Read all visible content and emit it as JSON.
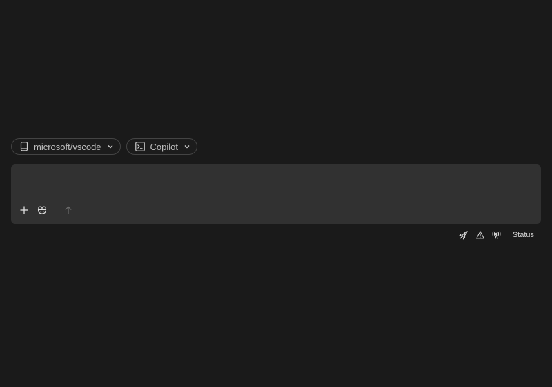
{
  "selectors": {
    "repo": {
      "label": "microsoft/vscode",
      "icon": "repo-icon"
    },
    "agent": {
      "label": "Copilot",
      "icon": "terminal-icon"
    }
  },
  "composer": {
    "placeholder": "",
    "value": "",
    "tools": {
      "add": "add-icon",
      "agent": "copilot-icon",
      "send": "arrow-up-icon"
    }
  },
  "status_bar": {
    "icons": [
      "rocket-icon",
      "warning-icon",
      "broadcast-icon"
    ],
    "label": "Status"
  },
  "colors": {
    "background": "#1a1a1a",
    "composer_bg": "#313131",
    "pill_border": "#444444",
    "text": "#bdbdbd"
  }
}
